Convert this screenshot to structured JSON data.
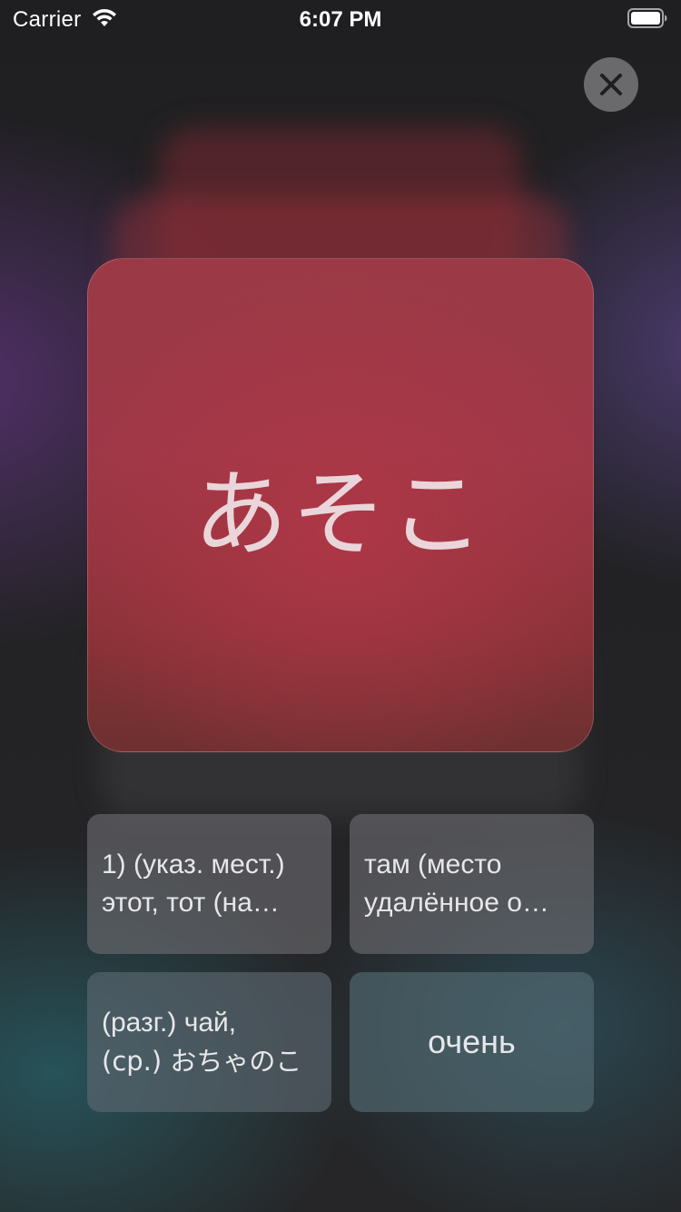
{
  "status_bar": {
    "carrier": "Carrier",
    "time": "6:07 PM",
    "wifi_icon": "wifi-icon",
    "battery_icon": "battery-full-icon"
  },
  "close_button": {
    "icon": "close-icon"
  },
  "card": {
    "word": "あそこ",
    "color": "#9c3848"
  },
  "answers": [
    {
      "line1": "1) (указ. мест.)",
      "line2": "этот, тот (на…"
    },
    {
      "line1": "там (место",
      "line2": "удалённое о…"
    },
    {
      "line1": "(разг.) чай,",
      "line2": "(ср.) おちゃのこ"
    },
    {
      "text": "очень"
    }
  ]
}
